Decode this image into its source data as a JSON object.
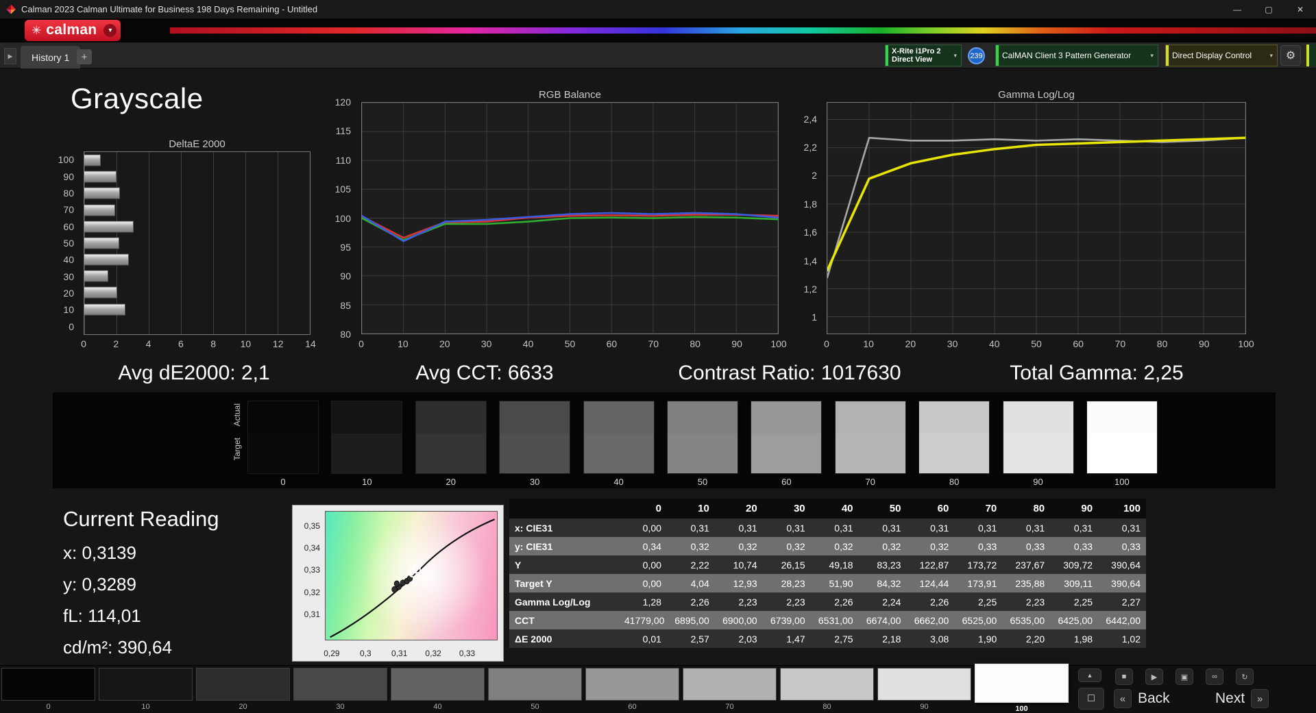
{
  "window": {
    "title": "Calman 2023 Calman Ultimate for Business 198 Days Remaining  - Untitled",
    "brand": "calman"
  },
  "icons": {
    "app": "◆",
    "brand_mark": "✳",
    "brand_caret": "▾",
    "minimize": "—",
    "maximize": "▢",
    "close": "✕",
    "tab_scroll": "▶",
    "add_tab": "+",
    "dropdown": "▾",
    "gear": "⚙",
    "caret_up": "▲",
    "stop": "■",
    "play": "▶",
    "save": "▣",
    "loop": "∞",
    "refresh": "↻",
    "window": "□",
    "back": "«",
    "next": "»"
  },
  "tab_bar": {
    "history_tab": "History 1"
  },
  "toolbar": {
    "meter_line1": "X-Rite i1Pro 2",
    "meter_line2": "Direct View",
    "meter_badge": "239",
    "pattern_generator": "CalMAN Client 3 Pattern Generator",
    "display_control": "Direct Display Control",
    "accent_green": "#35d44a",
    "accent_yellow": "#d0e020"
  },
  "page": {
    "title": "Grayscale"
  },
  "summary": {
    "avg_de2000": "Avg dE2000: 2,1",
    "avg_cct": "Avg CCT: 6633",
    "contrast_ratio": "Contrast Ratio: 1017630",
    "total_gamma": "Total Gamma: 2,25"
  },
  "chart_data": [
    {
      "name": "deltae_2000",
      "type": "bar",
      "title": "DeltaE 2000",
      "orientation": "horizontal",
      "categories": [
        "100",
        "90",
        "80",
        "70",
        "60",
        "50",
        "40",
        "30",
        "20",
        "10",
        "0"
      ],
      "values": [
        1.02,
        1.98,
        2.2,
        1.9,
        3.08,
        2.18,
        2.75,
        1.47,
        2.03,
        2.57,
        0.01
      ],
      "xlim": [
        0,
        14
      ],
      "xticks": [
        "0",
        "2",
        "4",
        "6",
        "8",
        "10",
        "12",
        "14"
      ],
      "grid": true
    },
    {
      "name": "rgb_balance",
      "type": "line",
      "title": "RGB Balance",
      "x": [
        0,
        10,
        20,
        30,
        40,
        50,
        60,
        70,
        80,
        90,
        100
      ],
      "xtick_labels": [
        "0",
        "10",
        "20",
        "30",
        "40",
        "50",
        "60",
        "70",
        "80",
        "90",
        "100"
      ],
      "ylim": [
        80,
        120
      ],
      "ypad": 0,
      "yticks": [
        120,
        115,
        110,
        105,
        100,
        95,
        90,
        85,
        80
      ],
      "ytick_labels": [
        "120",
        "115",
        "110",
        "105",
        "100",
        "95",
        "90",
        "85",
        "80"
      ],
      "grid": true,
      "series": [
        {
          "name": "Red",
          "color": "#d83434",
          "values": [
            100.3,
            96.6,
            99.3,
            99.4,
            100.1,
            100.4,
            100.5,
            100.4,
            100.6,
            100.6,
            100.4
          ]
        },
        {
          "name": "Green",
          "color": "#2fae2f",
          "values": [
            100.0,
            96.2,
            99.0,
            99.0,
            99.4,
            100.0,
            100.1,
            100.0,
            100.2,
            100.1,
            99.8
          ]
        },
        {
          "name": "Blue",
          "color": "#3a5ae0",
          "values": [
            100.4,
            96.0,
            99.4,
            99.7,
            100.2,
            100.7,
            100.9,
            100.7,
            100.9,
            100.7,
            100.1
          ]
        }
      ]
    },
    {
      "name": "gamma_log_log",
      "type": "line",
      "title": "Gamma Log/Log",
      "x": [
        0,
        10,
        20,
        30,
        40,
        50,
        60,
        70,
        80,
        90,
        100
      ],
      "xtick_labels": [
        "0",
        "10",
        "20",
        "30",
        "40",
        "50",
        "60",
        "70",
        "80",
        "90",
        "100"
      ],
      "ylim": [
        1.0,
        2.4
      ],
      "ypad": 0.085,
      "yticks": [
        2.4,
        2.2,
        2.0,
        1.8,
        1.6,
        1.4,
        1.2,
        1.0
      ],
      "ytick_labels": [
        "2,4",
        "2,2",
        "2",
        "1,8",
        "1,6",
        "1,4",
        "1,2",
        "1"
      ],
      "grid": true,
      "series": [
        {
          "name": "Per-point gamma",
          "color": "#a8a8a8",
          "width": 2.6,
          "values": [
            1.28,
            2.27,
            2.25,
            2.25,
            2.26,
            2.25,
            2.26,
            2.25,
            2.24,
            2.25,
            2.27
          ]
        },
        {
          "name": "Measured gamma",
          "color": "#e8e500",
          "width": 3.5,
          "values": [
            1.33,
            1.98,
            2.09,
            2.15,
            2.19,
            2.22,
            2.23,
            2.24,
            2.25,
            2.26,
            2.27
          ]
        }
      ]
    }
  ],
  "swatch_strip": {
    "row_labels": [
      "Actual",
      "Target"
    ],
    "levels": [
      "0",
      "10",
      "20",
      "30",
      "40",
      "50",
      "60",
      "70",
      "80",
      "90",
      "100"
    ],
    "actual_colors": [
      "#060606",
      "#141414",
      "#2e2e2e",
      "#4a4a4a",
      "#646464",
      "#808080",
      "#989898",
      "#b2b2b2",
      "#c8c8c8",
      "#e0e0e0",
      "#fcfcfc"
    ],
    "target_colors": [
      "#0a0a0a",
      "#1d1d1d",
      "#343434",
      "#4f4f4f",
      "#696969",
      "#858585",
      "#9d9d9d",
      "#b6b6b6",
      "#cccccc",
      "#e4e4e4",
      "#ffffff"
    ]
  },
  "current_reading": {
    "title": "Current Reading",
    "x": "x: 0,3139",
    "y": "y: 0,3289",
    "fl": "fL: 114,01",
    "cdm2": "cd/m²: 390,64"
  },
  "cie_chart": {
    "yticks": [
      "0,35",
      "0,34",
      "0,33",
      "0,32",
      "0,31"
    ],
    "xticks": [
      "0,29",
      "0,3",
      "0,31",
      "0,32",
      "0,33"
    ],
    "points": [
      {
        "type": "dot",
        "x": 0.3085,
        "y": 0.3212
      },
      {
        "type": "dot",
        "x": 0.3098,
        "y": 0.3224
      },
      {
        "type": "dot",
        "x": 0.3092,
        "y": 0.3238
      },
      {
        "type": "dot",
        "x": 0.311,
        "y": 0.3242
      },
      {
        "type": "dot",
        "x": 0.3122,
        "y": 0.325
      },
      {
        "type": "dot",
        "x": 0.3131,
        "y": 0.3262
      },
      {
        "type": "ring",
        "x": 0.3139,
        "y": 0.3289
      },
      {
        "type": "square",
        "x": 0.3152,
        "y": 0.3305
      }
    ]
  },
  "table": {
    "columns": [
      "",
      "0",
      "10",
      "20",
      "30",
      "40",
      "50",
      "60",
      "70",
      "80",
      "90",
      "100"
    ],
    "rows": [
      {
        "label": "x: CIE31",
        "values": [
          "0,00",
          "0,31",
          "0,31",
          "0,31",
          "0,31",
          "0,31",
          "0,31",
          "0,31",
          "0,31",
          "0,31",
          "0,31"
        ]
      },
      {
        "label": "y: CIE31",
        "values": [
          "0,34",
          "0,32",
          "0,32",
          "0,32",
          "0,32",
          "0,32",
          "0,32",
          "0,33",
          "0,33",
          "0,33",
          "0,33"
        ]
      },
      {
        "label": "Y",
        "values": [
          "0,00",
          "2,22",
          "10,74",
          "26,15",
          "49,18",
          "83,23",
          "122,87",
          "173,72",
          "237,67",
          "309,72",
          "390,64"
        ]
      },
      {
        "label": "Target Y",
        "values": [
          "0,00",
          "4,04",
          "12,93",
          "28,23",
          "51,90",
          "84,32",
          "124,44",
          "173,91",
          "235,88",
          "309,11",
          "390,64"
        ]
      },
      {
        "label": "Gamma Log/Log",
        "values": [
          "1,28",
          "2,26",
          "2,23",
          "2,23",
          "2,26",
          "2,24",
          "2,26",
          "2,25",
          "2,23",
          "2,25",
          "2,27"
        ]
      },
      {
        "label": "CCT",
        "values": [
          "41779,00",
          "6895,00",
          "6900,00",
          "6739,00",
          "6531,00",
          "6674,00",
          "6662,00",
          "6525,00",
          "6535,00",
          "6425,00",
          "6442,00"
        ]
      },
      {
        "label": "ΔE 2000",
        "values": [
          "0,01",
          "2,57",
          "2,03",
          "1,47",
          "2,75",
          "2,18",
          "3,08",
          "1,90",
          "2,20",
          "1,98",
          "1,02"
        ]
      }
    ]
  },
  "bottom_bar": {
    "levels": [
      "0",
      "10",
      "20",
      "30",
      "40",
      "50",
      "60",
      "70",
      "80",
      "90",
      "100"
    ],
    "colors": [
      "#050505",
      "#161616",
      "#2d2d2d",
      "#484848",
      "#636363",
      "#7f7f7f",
      "#989898",
      "#b1b1b1",
      "#c8c8c8",
      "#e0e0e0",
      "#fdfdfd"
    ],
    "active_level": "100",
    "back_label": "Back",
    "next_label": "Next"
  }
}
